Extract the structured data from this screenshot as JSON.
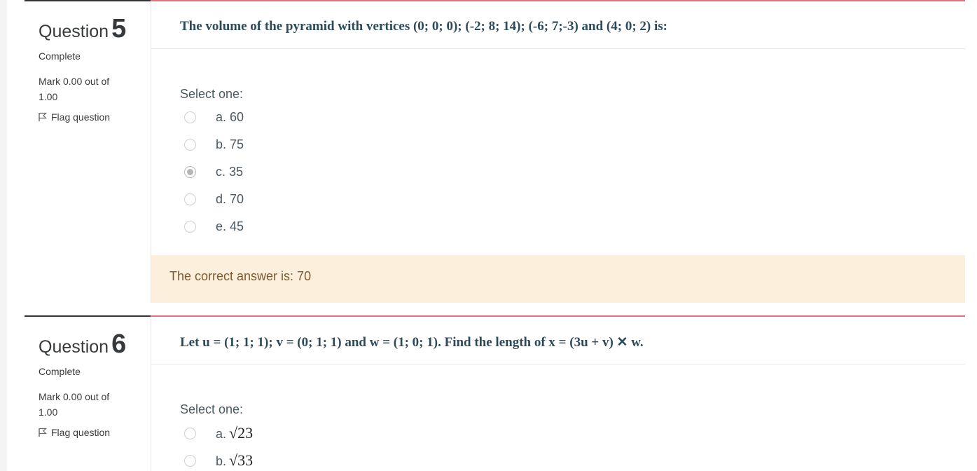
{
  "q5": {
    "label": "Question",
    "number": "5",
    "state": "Complete",
    "grade_line1": "Mark 0.00 out of",
    "grade_line2": "1.00",
    "flag_label": "Flag question",
    "text": "The volume of the pyramid with vertices (0; 0; 0); (-2; 8; 14); (-6; 7;-3) and (4; 0; 2) is:",
    "prompt": "Select one:",
    "options": [
      {
        "letter": "a.",
        "value": "60",
        "checked": false
      },
      {
        "letter": "b.",
        "value": "75",
        "checked": false
      },
      {
        "letter": "c.",
        "value": "35",
        "checked": true
      },
      {
        "letter": "d.",
        "value": "70",
        "checked": false
      },
      {
        "letter": "e.",
        "value": "45",
        "checked": false
      }
    ],
    "feedback": "The correct answer is: 70"
  },
  "q6": {
    "label": "Question",
    "number": "6",
    "state": "Complete",
    "grade_line1": "Mark 0.00 out of",
    "grade_line2": "1.00",
    "flag_label": "Flag question",
    "text": "Let u = (1; 1; 1); v = (0; 1; 1) and w = (1; 0; 1). Find the length of x = (3u + v) ✕ w.",
    "prompt": "Select one:",
    "options": [
      {
        "letter": "a.",
        "value": "√23",
        "checked": false
      },
      {
        "letter": "b.",
        "value": "√33",
        "checked": false
      }
    ]
  },
  "colors": {
    "accent_border": "#e8707e",
    "feedback_bg": "#fcefdc",
    "question_text": "#2c4a5a"
  }
}
